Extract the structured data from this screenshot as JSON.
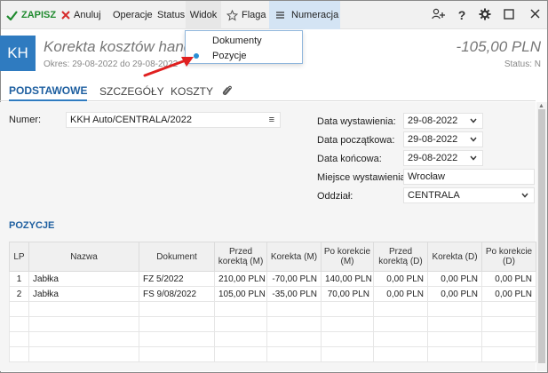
{
  "toolbar": {
    "save": "ZAPISZ",
    "cancel": "Anuluj",
    "operations": "Operacje",
    "status": "Status",
    "view": "Widok",
    "flag": "Flaga",
    "numbering": "Numeracja",
    "icons": [
      "add-user-icon",
      "help-icon",
      "gear-icon",
      "maximize-icon",
      "close-icon"
    ]
  },
  "view_menu": {
    "items": [
      {
        "label": "Dokumenty",
        "selected": false
      },
      {
        "label": "Pozycje",
        "selected": true
      }
    ]
  },
  "header": {
    "badge": "KH",
    "title": "Korekta kosztów handl",
    "period": "Okres: 29-08-2022 do 29-08-2022",
    "amount": "-105,00 PLN",
    "status": "Status: N"
  },
  "tabs": [
    "PODSTAWOWE",
    "SZCZEGÓŁY",
    "KOSZTY"
  ],
  "form": {
    "number_label": "Numer:",
    "number_value": "KKH Auto/CENTRALA/2022",
    "issue_date_label": "Data wystawienia:",
    "issue_date": "29-08-2022",
    "start_date_label": "Data początkowa:",
    "start_date": "29-08-2022",
    "end_date_label": "Data końcowa:",
    "end_date": "29-08-2022",
    "place_label": "Miejsce wystawienia:",
    "place": "Wrocław",
    "branch_label": "Oddział:",
    "branch": "CENTRALA"
  },
  "positions": {
    "title": "POZYCJE",
    "columns": [
      "LP",
      "Nazwa",
      "Dokument",
      "Przed korektą (M)",
      "Korekta (M)",
      "Po korekcie (M)",
      "Przed korektą (D)",
      "Korekta (D)",
      "Po korekcie (D)"
    ],
    "rows": [
      [
        "1",
        "Jabłka",
        "FZ 5/2022",
        "210,00 PLN",
        "-70,00 PLN",
        "140,00 PLN",
        "0,00 PLN",
        "0,00 PLN",
        "0,00 PLN"
      ],
      [
        "2",
        "Jabłka",
        "FS 9/08/2022",
        "105,00 PLN",
        "-35,00 PLN",
        "70,00 PLN",
        "0,00 PLN",
        "0,00 PLN",
        "0,00 PLN"
      ]
    ]
  },
  "colors": {
    "accent": "#2f7bc0",
    "save_green": "#1f8a2e",
    "cancel_red": "#d62b2b",
    "arrow_red": "#e02020"
  }
}
